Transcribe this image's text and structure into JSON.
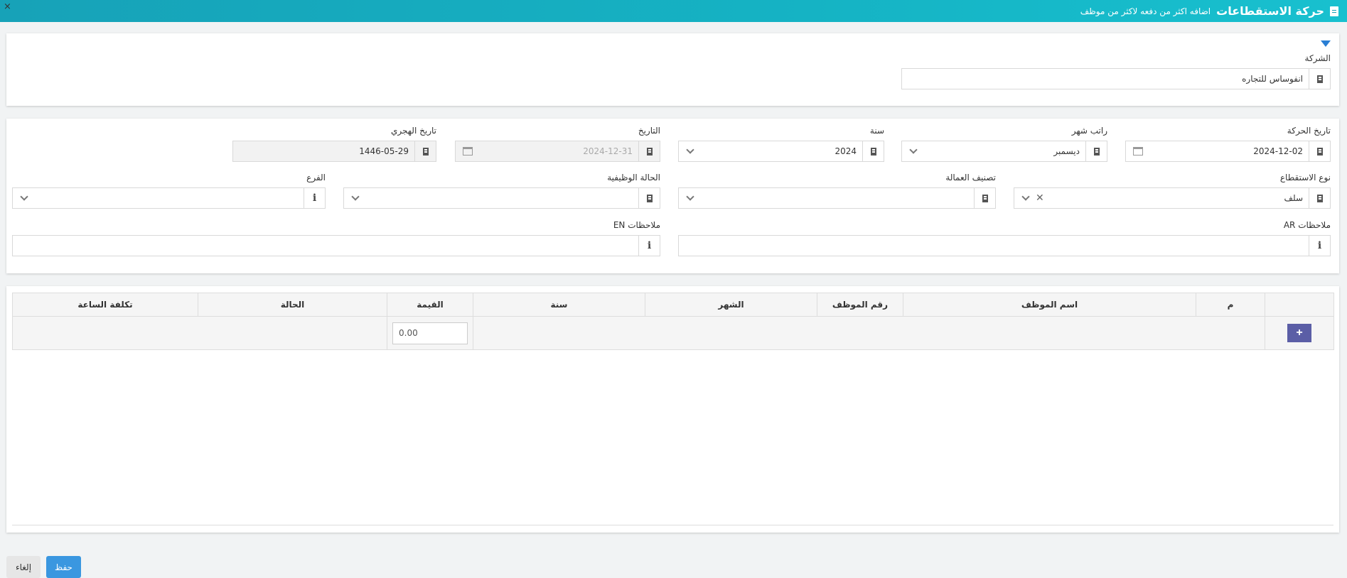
{
  "header": {
    "title": "حركة الاستقطاعات",
    "subtitle": "اضافه اكثر من دفعه لاكثر من موظف",
    "close_symbol": "×"
  },
  "filter": {
    "company_label": "الشركة",
    "company_value": "انفوساس للتجاره"
  },
  "form": {
    "movement_date_label": "تاريخ الحركة",
    "movement_date_value": "2024-12-02",
    "salary_month_label": "راتب شهر",
    "salary_month_value": "ديسمبر",
    "year_label": "سنة",
    "year_value": "2024",
    "date_label": "التاريخ",
    "date_value": "2024-12-31",
    "hijri_label": "تاريخ الهجري",
    "hijri_value": "1446-05-29",
    "deduction_type_label": "نوع الاستقطاع",
    "deduction_type_value": "سلف",
    "labor_class_label": "تصنيف العمالة",
    "labor_class_value": "",
    "job_status_label": "الحالة الوظيفية",
    "job_status_value": "",
    "branch_label": "الفرع",
    "branch_value": "",
    "notes_ar_label": "ملاحظات AR",
    "notes_en_label": "ملاحظات EN"
  },
  "table": {
    "columns": [
      "",
      "م",
      "اسم الموظف",
      "رقم الموظف",
      "الشهر",
      "سنة",
      "القيمة",
      "الحالة",
      "تكلفة الساعة"
    ],
    "add_label": "+",
    "value_default": "0.00"
  },
  "footer": {
    "save_label": "حفظ",
    "cancel_label": "إلغاء"
  },
  "colors": {
    "header_bg": "#17a2b8",
    "save_button": "#3a97e0",
    "add_button": "#5b5ea6",
    "filter_icon": "#2a7fd4"
  },
  "icons": [
    "document-icon",
    "filter-icon",
    "building-icon",
    "calendar-icon",
    "chevron-down-icon",
    "clear-icon",
    "info-icon",
    "close-icon"
  ]
}
